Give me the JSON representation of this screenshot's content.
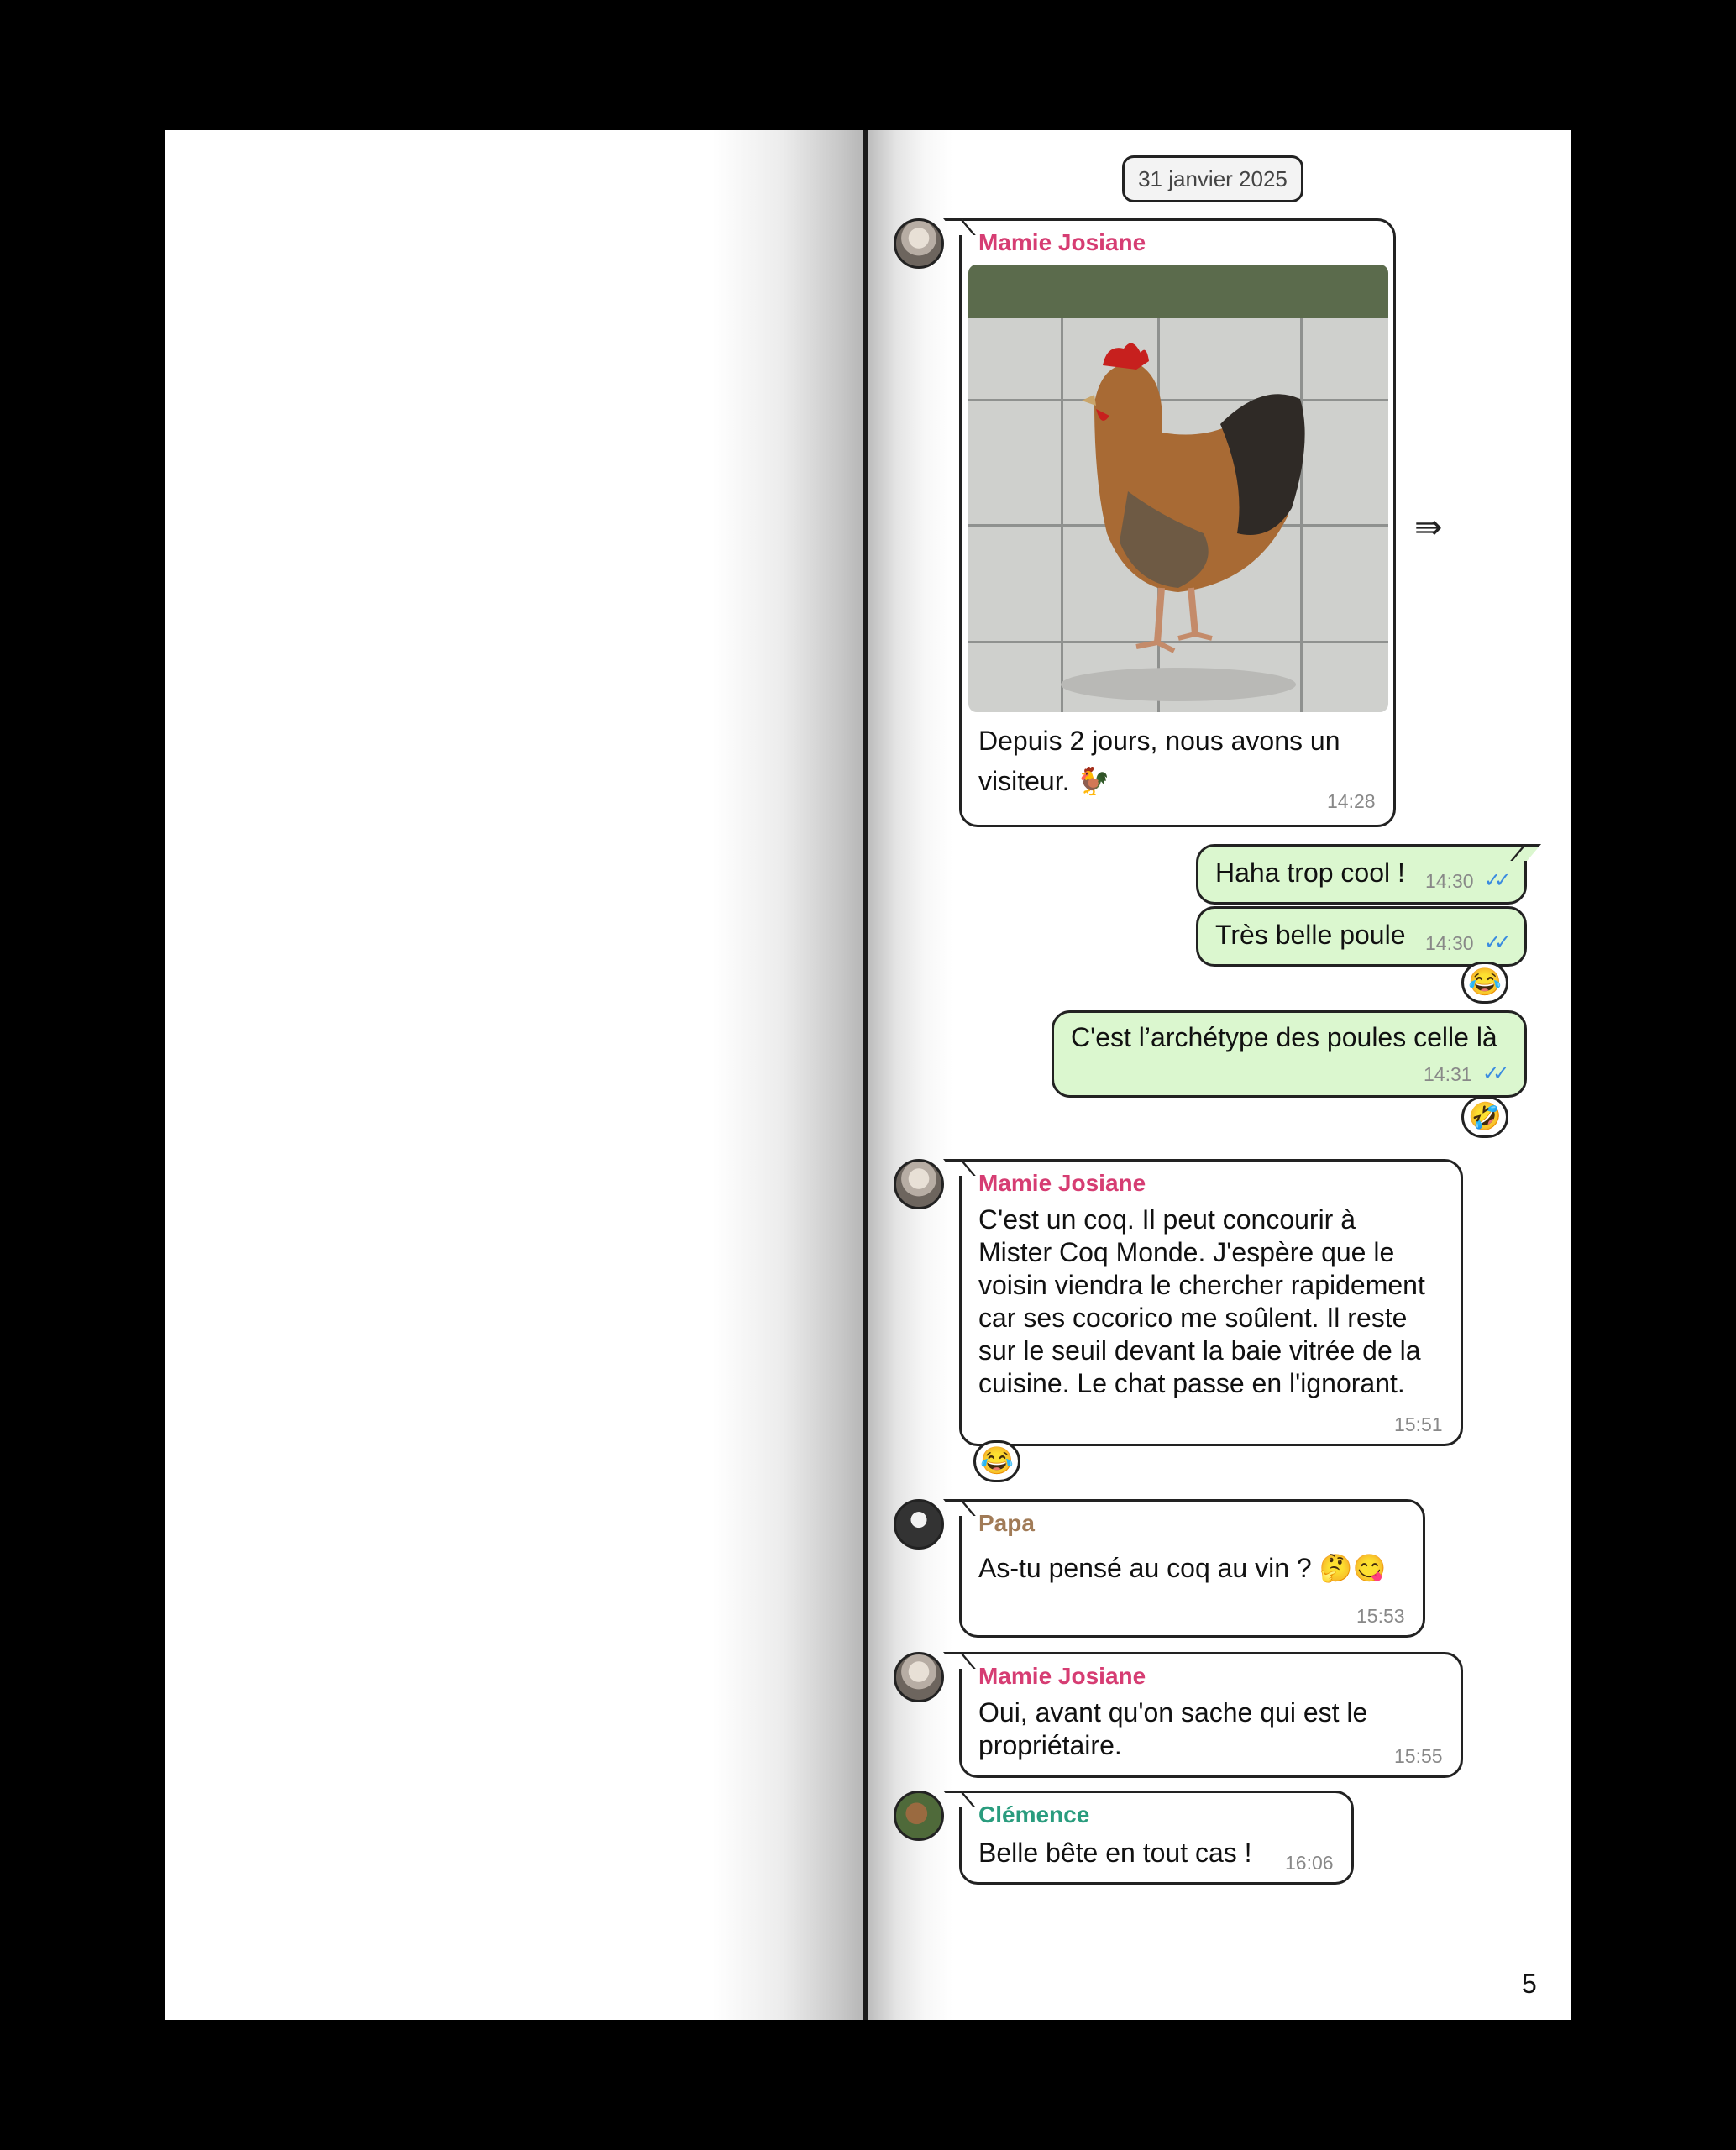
{
  "date_separator": "31 janvier 2025",
  "page_number": "5",
  "colors": {
    "mamie": "#d63d73",
    "papa": "#a17b57",
    "clemence": "#2a9c7e",
    "outgoing_bg": "#dbf7cf",
    "read_ticks": "#3a8be0"
  },
  "messages": {
    "m1": {
      "sender": "Mamie Josiane",
      "text_line1": "Depuis 2 jours, nous avons un",
      "text_line2": "visiteur. 🐓",
      "time": "14:28",
      "attachment": "rooster-photo"
    },
    "m2": {
      "text": "Haha trop cool !",
      "time": "14:30",
      "ticks": "✓✓"
    },
    "m3": {
      "text": "Très belle poule",
      "time": "14:30",
      "ticks": "✓✓",
      "reaction": "😂"
    },
    "m4": {
      "text": "C'est l’archétype des poules celle là",
      "time": "14:31",
      "ticks": "✓✓",
      "reaction": "🤣"
    },
    "m5": {
      "sender": "Mamie Josiane",
      "lines": [
        "C'est un coq. Il peut concourir à",
        "Mister Coq Monde. J'espère que le",
        "voisin viendra le chercher rapidement",
        "car ses cocorico me soûlent. Il reste",
        "sur le seuil  devant la baie vitrée de la",
        "cuisine. Le chat passe en l'ignorant."
      ],
      "time": "15:51",
      "reaction": "😂"
    },
    "m6": {
      "sender": "Papa",
      "text": "As-tu pensé au coq au vin ? 🤔😋",
      "time": "15:53"
    },
    "m7": {
      "sender": "Mamie Josiane",
      "text_line1": "Oui, avant qu'on sache qui est le",
      "text_line2": "propriétaire.",
      "time": "15:55"
    },
    "m8": {
      "sender": "Clémence",
      "text": "Belle bête en tout cas !",
      "time": "16:06"
    }
  },
  "icons": {
    "forward": "forward-icon",
    "read_receipt": "double-check-icon"
  }
}
